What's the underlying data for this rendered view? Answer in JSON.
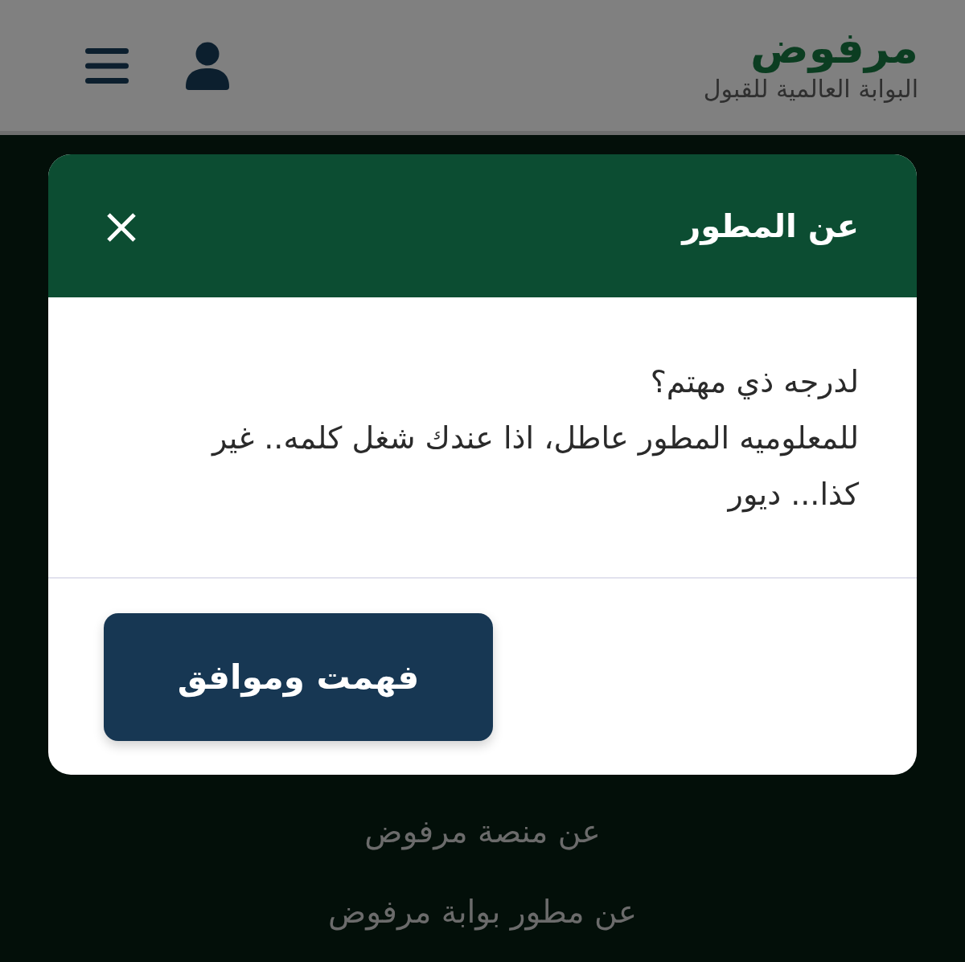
{
  "header": {
    "logo": "مرفوض",
    "tagline": "البوابة العالمية للقبول"
  },
  "modal": {
    "title": "عن المطور",
    "paragraphs": [
      "لدرجه ذي مهتم؟",
      "للمعلوميه المطور عاطل، اذا عندك شغل كلمه.. غير كذا... ديور"
    ],
    "button": "فهمت وموافق"
  },
  "footer_links": [
    "عن منصة مرفوض",
    "عن مطور بوابة مرفوض"
  ]
}
